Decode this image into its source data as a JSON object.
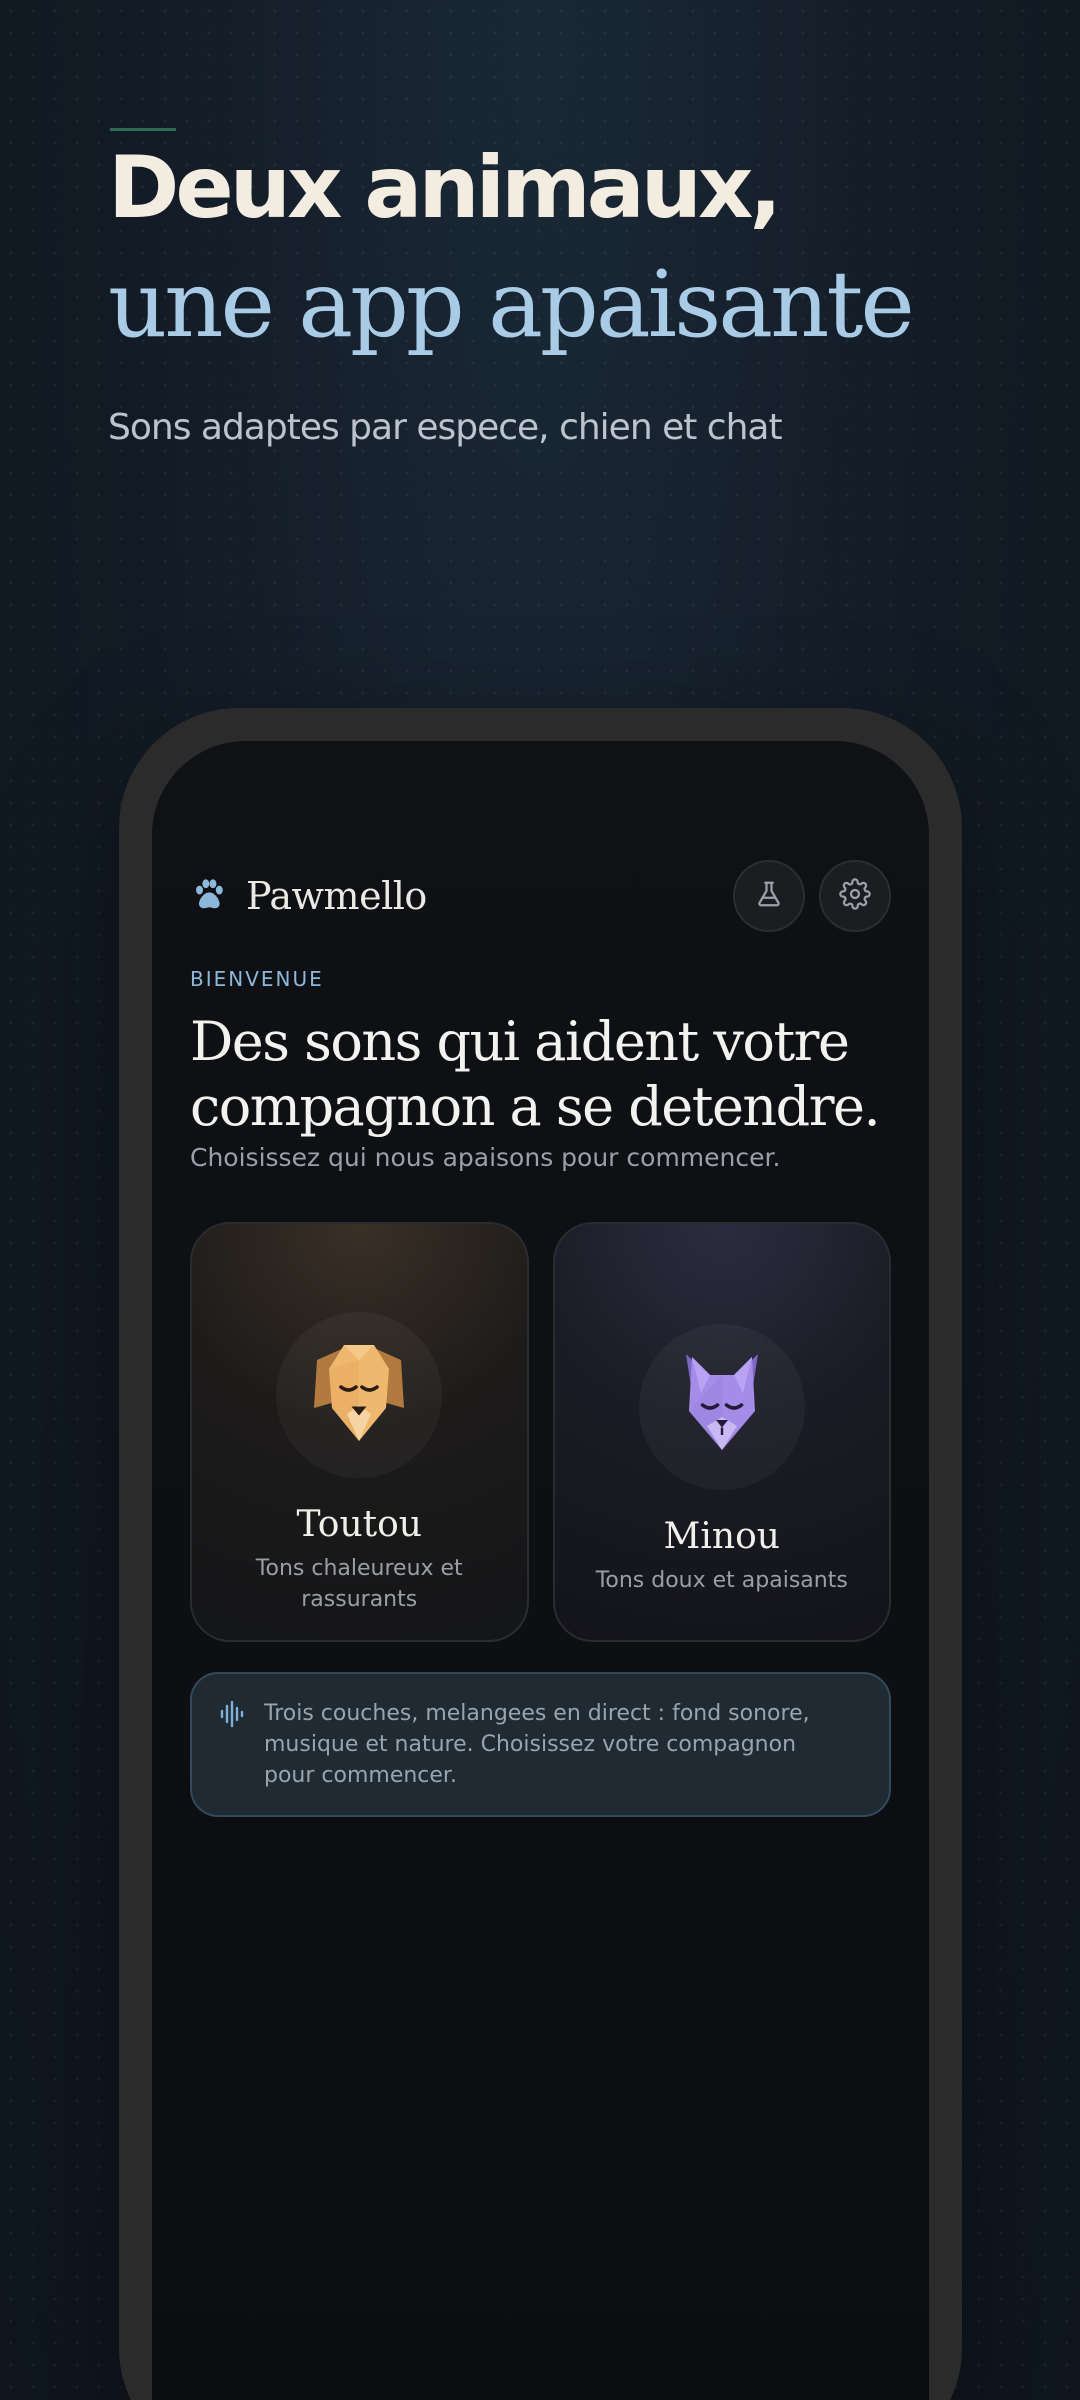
{
  "hero": {
    "headline": "Deux animaux,",
    "headline_accent": "une app apaisante",
    "subline": "Sons adaptes par espece, chien et chat"
  },
  "app": {
    "brand": {
      "name": "Pawmello",
      "icon": "paw-icon"
    },
    "actions": [
      {
        "icon": "flask-icon"
      },
      {
        "icon": "gear-icon"
      }
    ],
    "eyebrow": "BIENVENUE",
    "title_line1": "Des sons qui aident votre",
    "title_line2": "compagnon a se detendre.",
    "subtitle": "Choisissez qui nous apaisons pour commencer.",
    "pets": [
      {
        "name": "Toutou",
        "description": "Tons chaleureux et rassurants",
        "icon": "dog-icon"
      },
      {
        "name": "Minou",
        "description": "Tons doux et apaisants",
        "icon": "cat-icon"
      }
    ],
    "info": {
      "icon": "waveform-icon",
      "text": "Trois couches, melangees en direct : fond sonore, musique et nature. Choisissez votre compagnon pour commencer."
    }
  },
  "colors": {
    "accent_blue": "#a9cbe6",
    "dog_accent": "#e8a860",
    "cat_accent": "#9a82e0"
  }
}
